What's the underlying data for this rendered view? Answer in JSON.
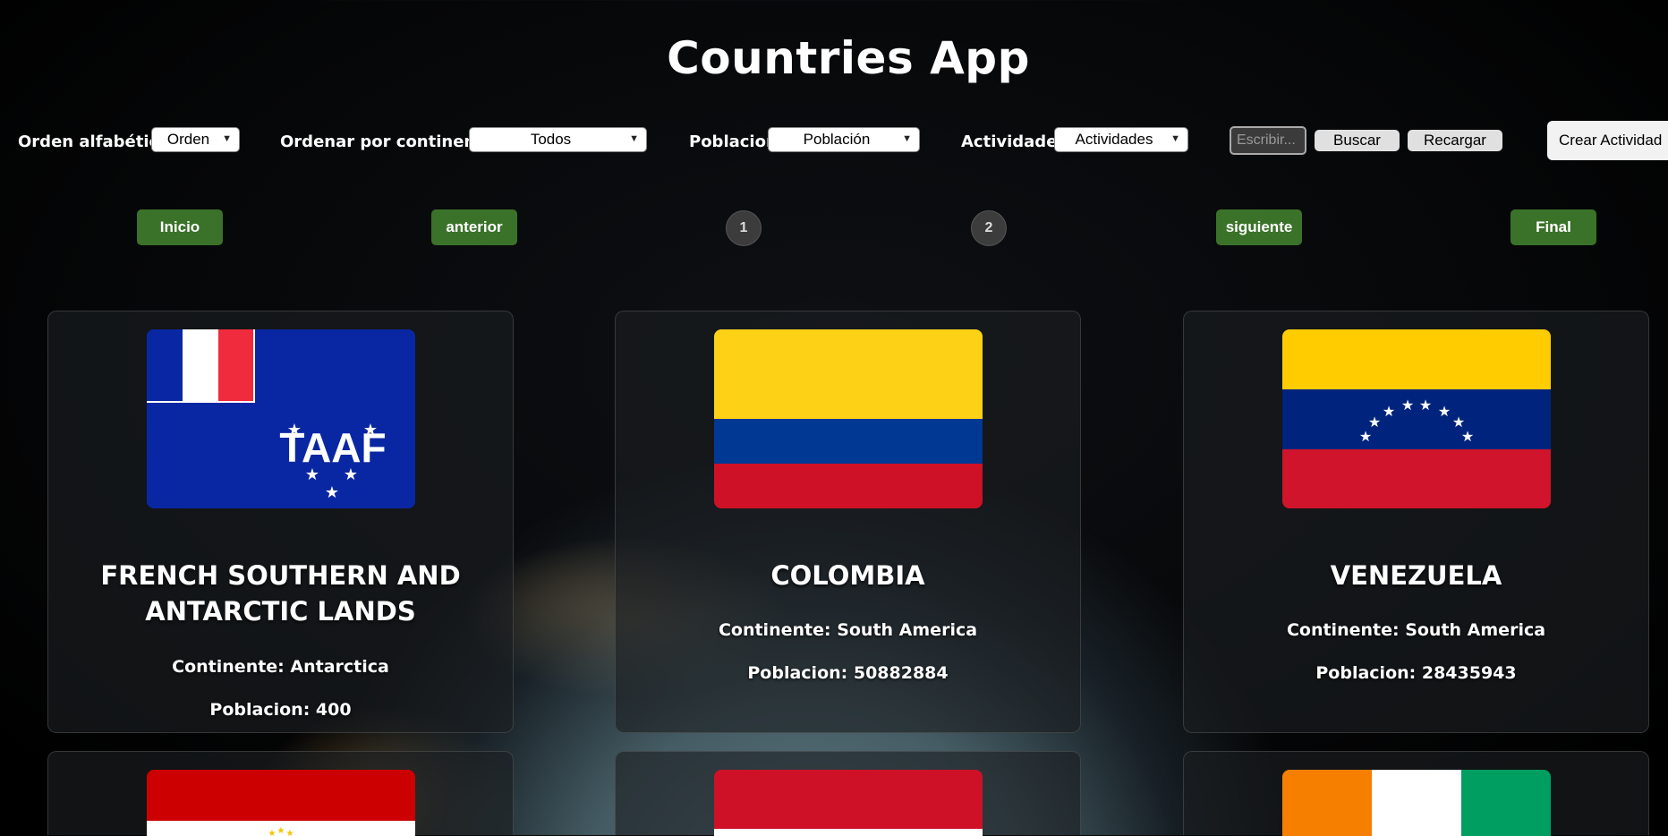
{
  "app": {
    "title": "Countries App"
  },
  "toolbar": {
    "alpha_label": "Orden alfabético",
    "alpha_value": "Orden",
    "continent_label": "Ordenar por continente:",
    "continent_value": "Todos",
    "population_label": "Poblacion",
    "population_value": "Población",
    "activities_label": "Actividades",
    "activities_value": "Actividades",
    "search_placeholder": "Escribir...",
    "search_button": "Buscar",
    "reload_button": "Recargar",
    "create_button": "Crear Actividad"
  },
  "pagination": {
    "first": "Inicio",
    "prev": "anterior",
    "pages": [
      "1",
      "2"
    ],
    "next": "siguiente",
    "last": "Final"
  },
  "countries": [
    {
      "name": "FRENCH SOUTHERN AND ANTARCTIC LANDS",
      "continent": "Continente: Antarctica",
      "population": "Poblacion: 400",
      "flag": "french-southern-flag"
    },
    {
      "name": "COLOMBIA",
      "continent": "Continente: South America",
      "population": "Poblacion: 50882884",
      "flag": "colombia-flag"
    },
    {
      "name": "VENEZUELA",
      "continent": "Continente: South America",
      "population": "Poblacion: 28435943",
      "flag": "venezuela-flag"
    },
    {
      "flag": "tajikistan-flag"
    },
    {
      "flag": "indonesia-flag"
    },
    {
      "flag": "ivory-coast-flag"
    }
  ],
  "colors": {
    "page_bg": "#000000",
    "pager_green": "#3a7229",
    "card_bg": "#1c1e22"
  }
}
